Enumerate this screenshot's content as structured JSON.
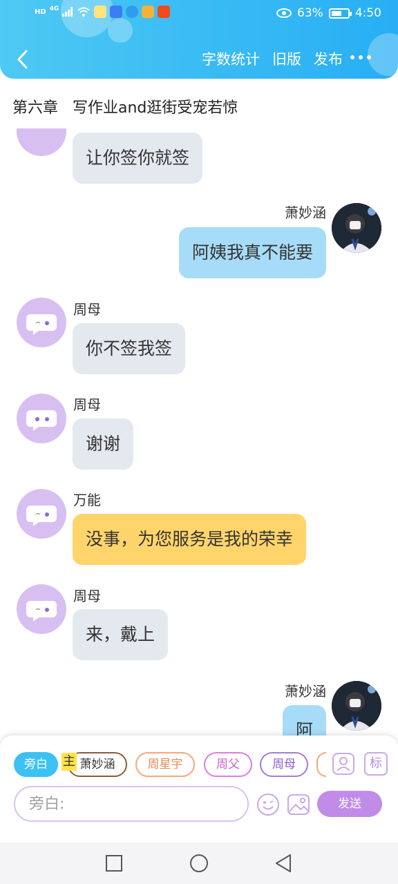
{
  "status_bar": {
    "network_badges": [
      "HD",
      "4G"
    ],
    "battery_percent": "63%",
    "battery_level": 0.63,
    "time": "4:50"
  },
  "nav": {
    "actions": [
      "字数统计",
      "旧版",
      "发布"
    ]
  },
  "chapter_title": "第六章   写作业and逛街受宠若惊",
  "messages": [
    {
      "side": "left",
      "sender": "",
      "text": "让你签你就签",
      "style": "gray"
    },
    {
      "side": "right",
      "sender": "萧妙涵",
      "text": "阿姨我真不能要",
      "style": "blue"
    },
    {
      "side": "left",
      "sender": "周母",
      "text": "你不签我签",
      "style": "gray"
    },
    {
      "side": "left",
      "sender": "周母",
      "text": "谢谢",
      "style": "gray"
    },
    {
      "side": "left",
      "sender": "万能",
      "text": "没事，为您服务是我的荣幸",
      "style": "yellow"
    },
    {
      "side": "left",
      "sender": "周母",
      "text": "来，戴上",
      "style": "gray"
    },
    {
      "side": "right",
      "sender": "萧妙涵",
      "text": "阿",
      "style": "blue"
    }
  ],
  "roles": {
    "narration": "旁白",
    "main_tag": "主",
    "characters": [
      "萧妙涵",
      "周星宇",
      "周父",
      "周母"
    ],
    "tag_button": "标"
  },
  "input": {
    "placeholder": "旁白:",
    "send_label": "发送"
  },
  "colors": {
    "header_start": "#4ec9f3",
    "header_end": "#27aef4",
    "bubble_gray": "#e4e8ef",
    "bubble_blue": "#a7dcf8",
    "bubble_yellow": "#ffd56b",
    "avatar_purple": "#d7bff2",
    "send_purple": "#c08ce8"
  }
}
